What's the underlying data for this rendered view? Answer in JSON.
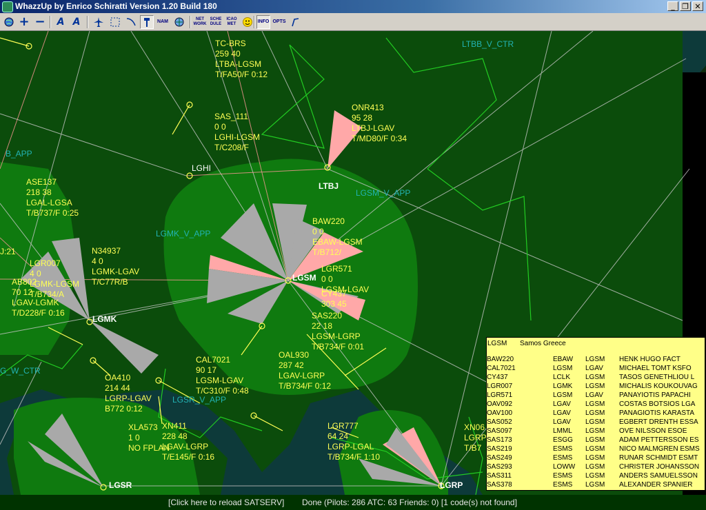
{
  "window": {
    "title": "WhazzUp by Enrico Schiratti Version 1.20 Build 180",
    "controls": {
      "minimize": "_",
      "restore": "❐",
      "close": "✕"
    }
  },
  "toolbar": {
    "zoom_in": "+",
    "zoom_out": "−",
    "font_smaller": "A",
    "font_larger": "A",
    "nam": "NAM",
    "net_work": "NET WORK",
    "sche_dule": "SCHE DULE",
    "icao_met": "ICAO MET",
    "info": "INFO",
    "opts": "OPTS"
  },
  "map": {
    "sectors": [
      "LTBB_V_CTR",
      "B_APP",
      "LGSM_V_APP",
      "LGMK_V_APP",
      "G_W_CTR",
      "LGSR_V_APP"
    ],
    "airports": [
      "LGHI",
      "LTBJ",
      "LGSM",
      "LGMK",
      "LGSR",
      "LGRP"
    ],
    "flights": [
      "TC-BRS\n259 40\nLTBA-LGSM\nT/FA50/F 0:12",
      "SAS_111\n0 0\nLGHI-LGSM\nT/C208/F",
      "ONR413\n95 28\nLTBJ-LGAV\nT/MD80/F 0:34",
      "ASE137\n218 38\nLGAL-LGSA\nT/B737/F 0:25",
      "BAW220\n0 0\nEBAW-LGSM\nT/B712/",
      "N34937\n4 0\nLGMK-LGAV\nT/C77R/B",
      "LGR007\n4 0\nLGMK-LGSM\nT/B734/A",
      "LGR571\n0 0\nLGSM-LGAV",
      "CY437\n303 45",
      "AB802\n70 12\nLGAV-LGMK\nT/D228/F 0:16",
      "SAS220\n22 18\nLGSM-LGRP\nT/B734/F 0:01",
      "CAL7021\n90 17\nLGSM-LGAV\nT/C310/F 0:48",
      "OAL930\n287 42\nLGAV-LGRP\nT/B734/F 0:12",
      "OA410\n214 44\nLGRP-LGAV\nB772 0:12",
      "XLA573\n1 0\nNO FPLAN",
      "XN411\n228 48\nLGAV-LGRP\nT/E145/F 0:16",
      "LGR777\n64 24\nLGRP-LGAL\nT/B734/F 1:10",
      "XN06\nLGRP\nT/B7",
      "J:21"
    ]
  },
  "info_panel": {
    "code": "LGSM",
    "name": "Samos Greece",
    "rows": [
      [
        "BAW220",
        "EBAW",
        "LGSM",
        "HENK HUGO FACT"
      ],
      [
        "CAL7021",
        "LGSM",
        "LGAV",
        "MICHAEL TOMT KSFO"
      ],
      [
        "CY437",
        "LCLK",
        "LGSM",
        "TASOS GENETHLIOU L"
      ],
      [
        "LGR007",
        "LGMK",
        "LGSM",
        "MICHALIS KOUKOUVAG"
      ],
      [
        "LGR571",
        "LGSM",
        "LGAV",
        "PANAYIOTIS PAPACHI"
      ],
      [
        "OAV092",
        "LGAV",
        "LGSM",
        "COSTAS BOTSIOS LGA"
      ],
      [
        "OAV100",
        "LGAV",
        "LGSM",
        "PANAGIOTIS KARASTA"
      ],
      [
        "SAS052",
        "LGAV",
        "LGSM",
        "EGBERT DRENTH ESSA"
      ],
      [
        "SAS097",
        "LMML",
        "LGSM",
        "OVE NILSSON ESOE"
      ],
      [
        "SAS173",
        "ESGG",
        "LGSM",
        "ADAM PETTERSSON ES"
      ],
      [
        "SAS219",
        "ESMS",
        "LGSM",
        "NICO MALMGREN ESMS"
      ],
      [
        "SAS249",
        "ESMS",
        "LGSM",
        "RUNAR SCHMIDT ESMT"
      ],
      [
        "SAS293",
        "LOWW",
        "LGSM",
        "CHRISTER JOHANSSON"
      ],
      [
        "SAS311",
        "ESMS",
        "LGSM",
        "ANDERS SAMUELSSON"
      ],
      [
        "SAS378",
        "ESMS",
        "LGSM",
        "ALEXANDER SPANIER"
      ]
    ]
  },
  "status": {
    "reload": "[Click here to reload SATSERV]",
    "done": "Done (Pilots: 286  ATC: 63  Friends: 0) [1 code(s) not found]"
  },
  "colors": {
    "sea": "#0d3a3a",
    "land": "#0b4c0b",
    "app_zone": "#0f7a0f",
    "flight_label": "#ffff55",
    "sector_label": "#22b3b3",
    "approach_pink": "#ffa8a8",
    "approach_grey": "#a9a9a9",
    "info_panel": "#ffff88"
  }
}
